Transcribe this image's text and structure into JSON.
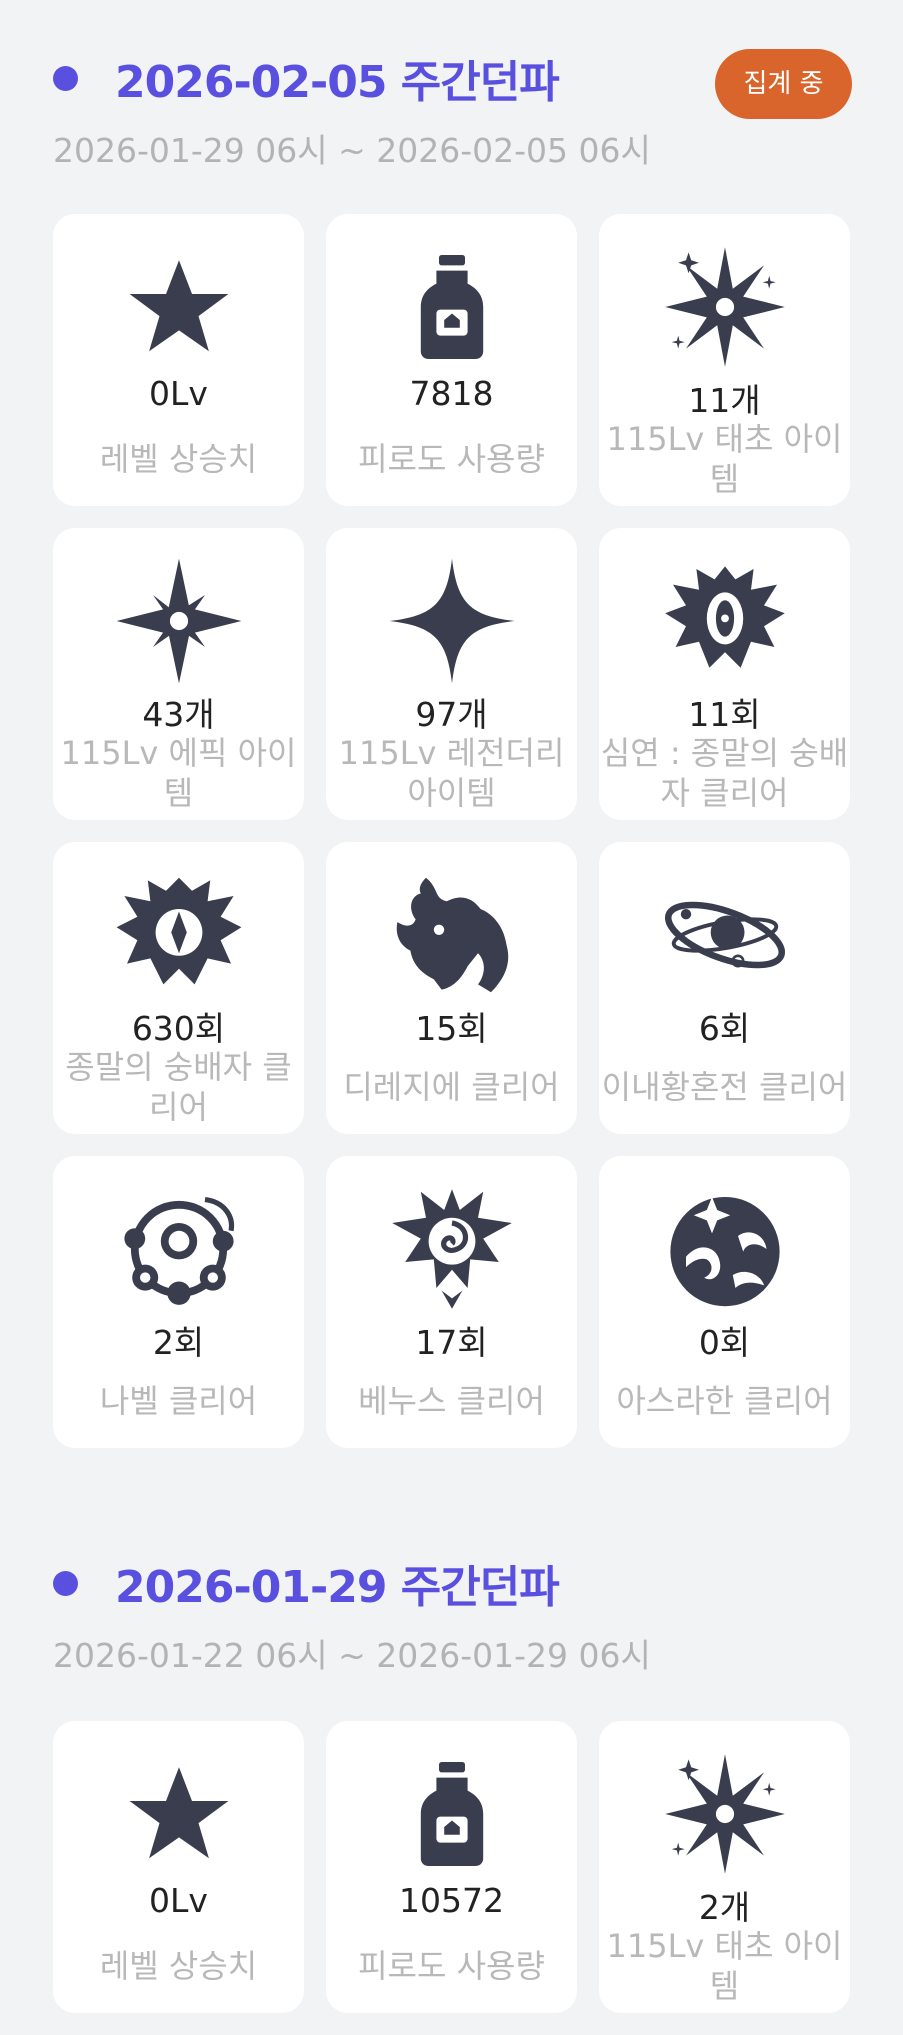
{
  "weeks": [
    {
      "title": "2026-02-05 주간던파",
      "range": "2026-01-29 06시 ~ 2026-02-05 06시",
      "status": "집계 중",
      "cards": [
        {
          "icon": "star-icon",
          "value": "0Lv",
          "label": "레벨 상승치"
        },
        {
          "icon": "potion-bottle-icon",
          "value": "7818",
          "label": "피로도 사용량"
        },
        {
          "icon": "taecho-burst-icon",
          "value": "11개",
          "label": "115Lv 태초 아이템"
        },
        {
          "icon": "epic-star-icon",
          "value": "43개",
          "label": "115Lv 에픽 아이템"
        },
        {
          "icon": "legendary-sparkle-icon",
          "value": "97개",
          "label": "115Lv 레전더리 아이템"
        },
        {
          "icon": "abyss-crest-icon",
          "value": "11회",
          "label": "심연 : 종말의 숭배자 클리어"
        },
        {
          "icon": "cult-crest-icon",
          "value": "630회",
          "label": "종말의 숭배자 클리어"
        },
        {
          "icon": "dragon-head-icon",
          "value": "15회",
          "label": "디레지에 클리어"
        },
        {
          "icon": "orbit-planet-icon",
          "value": "6회",
          "label": "이내황혼전 클리어"
        },
        {
          "icon": "gear-orbs-icon",
          "value": "2회",
          "label": "나벨 클리어"
        },
        {
          "icon": "rose-emblem-icon",
          "value": "17회",
          "label": "베누스 클리어"
        },
        {
          "icon": "wave-circle-icon",
          "value": "0회",
          "label": "아스라한 클리어"
        }
      ]
    },
    {
      "title": "2026-01-29 주간던파",
      "range": "2026-01-22 06시 ~ 2026-01-29 06시",
      "cards": [
        {
          "icon": "star-icon",
          "value": "0Lv",
          "label": "레벨 상승치"
        },
        {
          "icon": "potion-bottle-icon",
          "value": "10572",
          "label": "피로도 사용량"
        },
        {
          "icon": "taecho-burst-icon",
          "value": "2개",
          "label": "115Lv 태초 아이템"
        }
      ]
    }
  ]
}
